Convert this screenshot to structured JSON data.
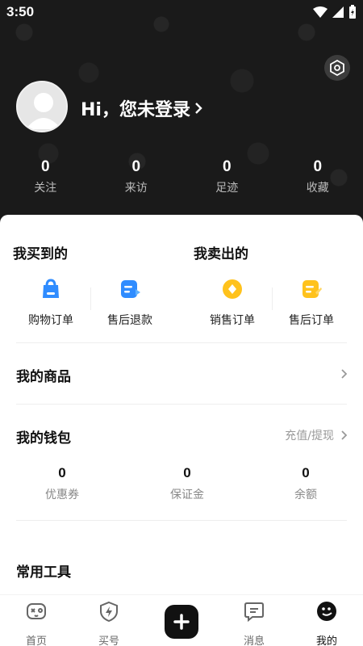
{
  "status_bar": {
    "time": "3:50"
  },
  "profile": {
    "login_prompt": "Hi，您未登录"
  },
  "stats": [
    {
      "value": "0",
      "label": "关注"
    },
    {
      "value": "0",
      "label": "来访"
    },
    {
      "value": "0",
      "label": "足迹"
    },
    {
      "value": "0",
      "label": "收藏"
    }
  ],
  "trade": {
    "bought_title": "我买到的",
    "sold_title": "我卖出的",
    "items": [
      {
        "label": "购物订单",
        "icon": "shopping-bag-icon"
      },
      {
        "label": "售后退款",
        "icon": "refund-doc-icon"
      },
      {
        "label": "销售订单",
        "icon": "coin-icon"
      },
      {
        "label": "售后订单",
        "icon": "after-sale-doc-icon"
      }
    ]
  },
  "my_goods": {
    "title": "我的商品"
  },
  "wallet": {
    "title": "我的钱包",
    "action": "充值/提现",
    "items": [
      {
        "value": "0",
        "label": "优惠券"
      },
      {
        "value": "0",
        "label": "保证金"
      },
      {
        "value": "0",
        "label": "余额"
      }
    ]
  },
  "tools": {
    "title": "常用工具"
  },
  "nav": {
    "items": [
      {
        "label": "首页",
        "icon": "game-controller-icon"
      },
      {
        "label": "买号",
        "icon": "shield-bolt-icon"
      },
      {
        "label": "",
        "icon": "plus-icon"
      },
      {
        "label": "消息",
        "icon": "chat-icon"
      },
      {
        "label": "我的",
        "icon": "smile-face-icon"
      }
    ],
    "active": "我的"
  },
  "colors": {
    "accent_blue": "#2f8cff",
    "accent_yellow": "#ffc21c",
    "header_bg": "#1a1a1a"
  }
}
